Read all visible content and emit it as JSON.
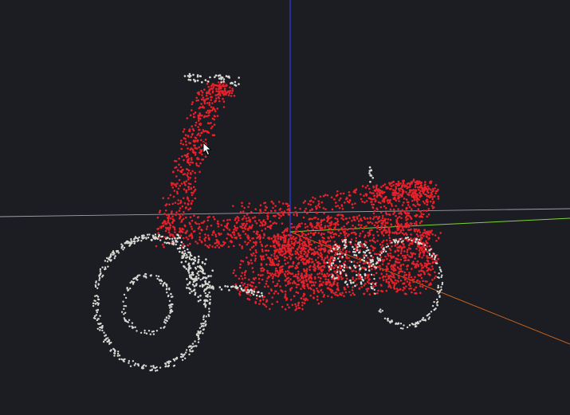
{
  "viewer": {
    "background_color": "#1c1c23",
    "point_colors": {
      "segment_body": "#e8212a",
      "segment_wheels": "#d9d9d4"
    },
    "axis_colors": {
      "x": "#c8641e",
      "y": "#2a3fd8",
      "z": "#7fd43a",
      "grid": "#9aa0a6"
    },
    "cursor_icon": "arrow-cursor-icon"
  }
}
